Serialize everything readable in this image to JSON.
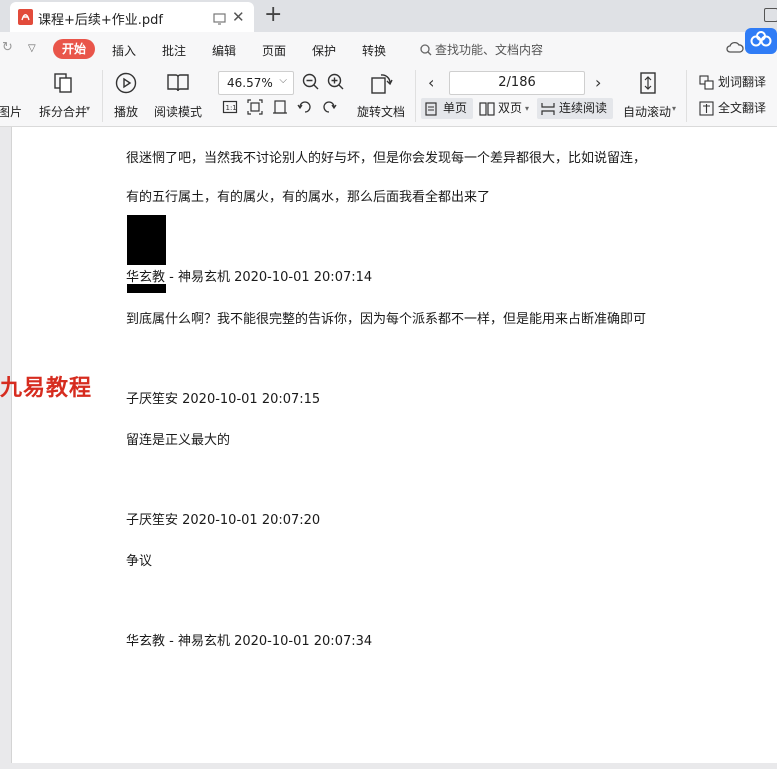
{
  "tab": {
    "title": "课程+后续+作业.pdf"
  },
  "menu": {
    "start": "开始",
    "items": [
      "插入",
      "批注",
      "编辑",
      "页面",
      "保护",
      "转换"
    ],
    "search_placeholder": "查找功能、文档内容"
  },
  "toolbar": {
    "image_tool": "图片",
    "split_merge": "拆分合并",
    "play": "播放",
    "read_mode": "阅读模式",
    "zoom": "46.57%",
    "rotate": "旋转文档",
    "page": "2/186",
    "single_page": "单页",
    "double_page": "双页",
    "continuous": "连续阅读",
    "auto_scroll": "自动滚动",
    "word_translate": "划词翻译",
    "full_translate": "全文翻译"
  },
  "colors": {
    "accent": "#e9554a",
    "watermark": "#d62c1f",
    "badge": "#2f7cf6"
  },
  "document": {
    "lines": [
      "很迷惘了吧，当然我不讨论别人的好与坏，但是你会发现每一个差异都很大，比如说留连，",
      "有的五行属土，有的属火，有的属水，那么后面我看全都出来了",
      "华玄教 - 神易玄机 2020-10-01 20:07:14",
      "到底属什么啊？我不能很完整的告诉你，因为每个派系都不一样，但是能用来占断准确即可",
      "子厌笙安 2020-10-01 20:07:15",
      "留连是正义最大的",
      "子厌笙安 2020-10-01 20:07:20",
      "争议",
      "华玄教 - 神易玄机 2020-10-01 20:07:34"
    ],
    "watermark": "九易教程"
  }
}
